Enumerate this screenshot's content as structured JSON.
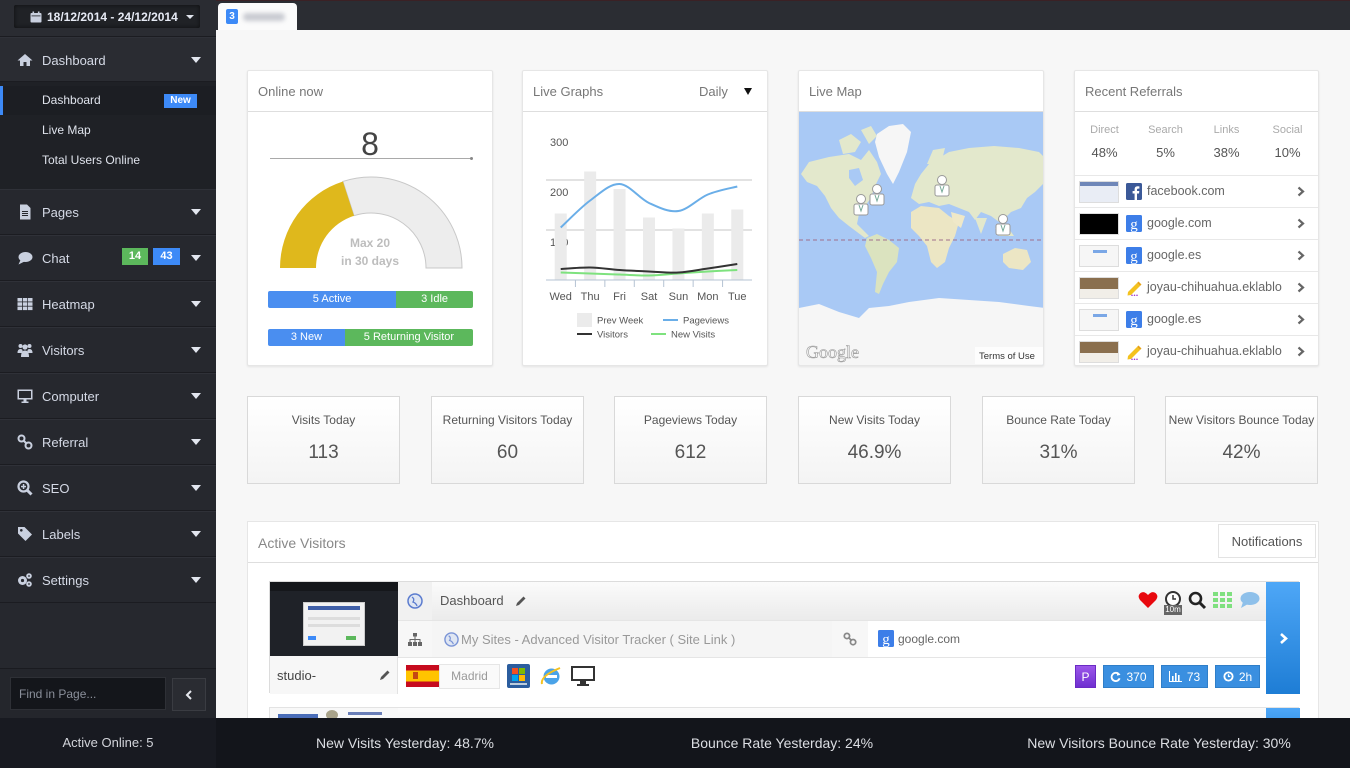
{
  "header": {
    "date_range": "18/12/2014 - 24/12/2014",
    "tab_badge": "3"
  },
  "sidebar": {
    "dashboard": {
      "label": "Dashboard",
      "submenu": [
        {
          "label": "Dashboard",
          "badge": "New",
          "active": true
        },
        {
          "label": "Live Map"
        },
        {
          "label": "Total Users Online"
        }
      ]
    },
    "items": [
      {
        "label": "Pages",
        "icon": "file-icon"
      },
      {
        "label": "Chat",
        "icon": "chat-icon",
        "badge_green": "14",
        "badge_blue": "43"
      },
      {
        "label": "Heatmap",
        "icon": "grid-icon"
      },
      {
        "label": "Visitors",
        "icon": "users-icon"
      },
      {
        "label": "Computer",
        "icon": "monitor-icon"
      },
      {
        "label": "Referral",
        "icon": "link-icon"
      },
      {
        "label": "SEO",
        "icon": "zoom-in-icon"
      },
      {
        "label": "Labels",
        "icon": "tag-icon"
      },
      {
        "label": "Settings",
        "icon": "gears-icon"
      }
    ],
    "search_placeholder": "Find in Page...",
    "active_online": "Active Online: 5"
  },
  "online_now": {
    "title": "Online now",
    "count": "8",
    "gauge_value": 8,
    "gauge_max": 20,
    "max_line1": "Max 20",
    "max_line2": "in 30 days",
    "active": {
      "label": "5 Active",
      "value": 5
    },
    "idle": {
      "label": "3 Idle",
      "value": 3
    },
    "new": {
      "label": "3 New",
      "value": 3
    },
    "returning": {
      "label": "5 Returning Visitor",
      "value": 5
    },
    "colors": {
      "gauge_fill": "#dfb81c",
      "gauge_empty": "#ededed",
      "blue": "#4a8ef0",
      "green": "#5cb85c"
    }
  },
  "live_graphs": {
    "title": "Live Graphs",
    "period": "Daily"
  },
  "chart_data": {
    "type": "line",
    "title": "Live Graphs",
    "categories": [
      "Wed",
      "Thu",
      "Fri",
      "Sat",
      "Sun",
      "Mon",
      "Tue"
    ],
    "series": [
      {
        "name": "Prev Week",
        "type": "bar",
        "color": "#ebebeb",
        "values": [
          133,
          217,
          182,
          125,
          103,
          133,
          141
        ]
      },
      {
        "name": "Pageviews",
        "type": "line",
        "color": "#6aaee8",
        "values": [
          105,
          159,
          192,
          154,
          138,
          171,
          187
        ]
      },
      {
        "name": "Visitors",
        "type": "line",
        "color": "#333333",
        "values": [
          22,
          25,
          20,
          17,
          15,
          23,
          32
        ]
      },
      {
        "name": "New Visits",
        "type": "line",
        "color": "#7ee27e",
        "values": [
          15,
          13,
          11,
          9,
          13,
          17,
          20
        ]
      }
    ],
    "yticks": [
      100,
      200,
      300
    ],
    "ylim": [
      0,
      300
    ],
    "xlabel": "",
    "ylabel": "",
    "grid": true,
    "legend": "bottom"
  },
  "live_map": {
    "title": "Live Map",
    "logo": "Google",
    "terms": "Terms of Use"
  },
  "referrals": {
    "title": "Recent Referrals",
    "stats": [
      {
        "label": "Direct",
        "value": "48%"
      },
      {
        "label": "Search",
        "value": "5%"
      },
      {
        "label": "Links",
        "value": "38%"
      },
      {
        "label": "Social",
        "value": "10%"
      }
    ],
    "items": [
      {
        "site": "facebook.com",
        "icon": "facebook-icon"
      },
      {
        "site": "google.com",
        "icon": "google-icon"
      },
      {
        "site": "google.es",
        "icon": "google-icon"
      },
      {
        "site": "joyau-chihuahua.eklablo",
        "icon": "pencil-icon"
      },
      {
        "site": "google.es",
        "icon": "google-icon"
      },
      {
        "site": "joyau-chihuahua.eklablo",
        "icon": "pencil-icon"
      }
    ]
  },
  "stats": [
    {
      "label": "Visits Today",
      "value": "113"
    },
    {
      "label": "Returning Visitors Today",
      "value": "60"
    },
    {
      "label": "Pageviews Today",
      "value": "612"
    },
    {
      "label": "New Visits Today",
      "value": "46.9%"
    },
    {
      "label": "Bounce Rate Today",
      "value": "31%"
    },
    {
      "label": "New Visitors Bounce Today",
      "value": "42%"
    }
  ],
  "active_visitors": {
    "title": "Active Visitors",
    "notifications_label": "Notifications",
    "visitors": [
      {
        "name": "studio-",
        "page": "Dashboard",
        "site_link": "My Sites - Advanced Visitor Tracker ( Site Link )",
        "referrer": "google.com",
        "city": "Madrid",
        "country_flag": "spain-flag",
        "os": "windows-7",
        "browser": "internet-explorer",
        "device": "desktop",
        "time_tag": "10m",
        "plan_badge": "P",
        "badge_refresh": "370",
        "badge_chart": "73",
        "badge_clock": "2h"
      }
    ]
  },
  "footer": {
    "new_visits_yesterday": "New Visits Yesterday: 48.7%",
    "bounce_rate_yesterday": "Bounce Rate Yesterday: 24%",
    "new_visitors_bounce_yesterday": "New Visitors Bounce Rate Yesterday: 30%"
  }
}
